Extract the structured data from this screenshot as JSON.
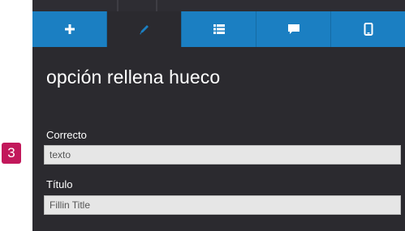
{
  "toolbar": {
    "tabs": [
      {
        "icon": "plus-icon",
        "active": false
      },
      {
        "icon": "pencil-icon",
        "active": true
      },
      {
        "icon": "list-icon",
        "active": false
      },
      {
        "icon": "chat-bubble-icon",
        "active": false
      },
      {
        "icon": "mobile-device-icon",
        "active": false
      }
    ],
    "accent_color": "#1b7fc2"
  },
  "panel": {
    "title": "opción rellena hueco"
  },
  "fields": {
    "correct": {
      "label": "Correcto",
      "value": "texto"
    },
    "title": {
      "label": "Título",
      "value": "Fillin Title"
    }
  },
  "callout": {
    "number": "3",
    "color": "#c2185b"
  }
}
